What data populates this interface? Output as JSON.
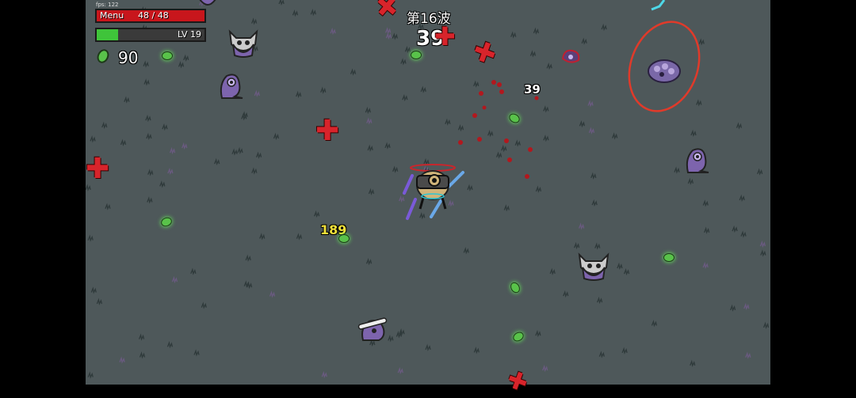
{
  "hud": {
    "fps": "fps: 122",
    "hp_label": "Menu",
    "hp_value": "48 / 48",
    "hp_fraction": 1.0,
    "xp_level": "LV 19",
    "xp_fraction": 0.2,
    "materials": "90"
  },
  "wave": {
    "title": "第16波",
    "timer": "39"
  },
  "damage_numbers": [
    {
      "text": "39",
      "color": "#ffffff"
    },
    {
      "text": "189",
      "color": "#f2e13a"
    }
  ],
  "colors": {
    "ground": "#4e585a",
    "hp": "#c8161c",
    "xp": "#3fc43a",
    "enemy": "#8064b4",
    "material": "#59c24a",
    "target_ring": "#e03a2a",
    "cross": "#d8242b"
  },
  "icons": {
    "material": "green-material-icon",
    "spawn_marker": "red-cross-icon",
    "player": "potato-player-icon"
  }
}
